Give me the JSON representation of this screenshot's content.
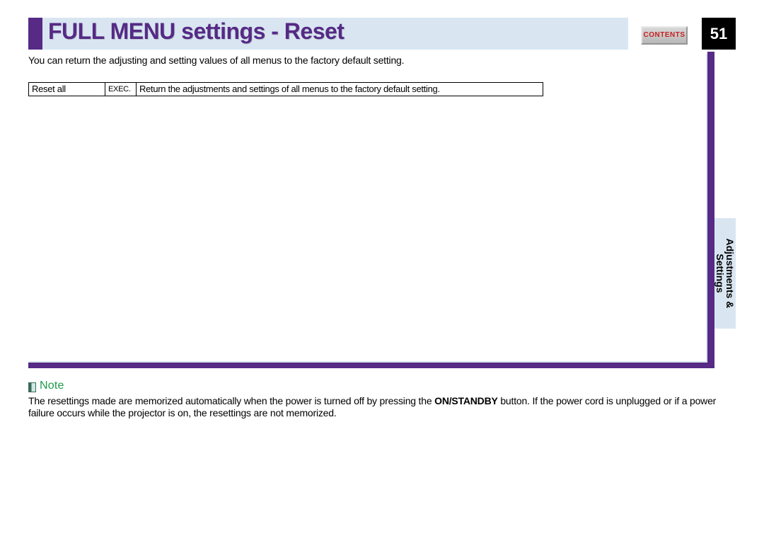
{
  "header": {
    "title": "FULL MENU settings - Reset",
    "contents_label": "CONTENTS",
    "page_number": "51"
  },
  "intro": "You can return the adjusting and setting values of all menus to the factory default setting.",
  "table": {
    "row1": {
      "name": "Reset all",
      "action": "EXEC.",
      "description": "Return the adjustments and settings of all menus to the factory default setting."
    }
  },
  "side_tab": {
    "line1": "Adjustments &",
    "line2": "Settings"
  },
  "note": {
    "label": "Note",
    "body_before": "The resettings made are memorized automatically when the power is turned off by pressing the ",
    "body_bold": "ON/STANDBY",
    "body_after": " button. If the power cord is unplugged or if a power failure occurs while the projector is on, the resettings are not memorized."
  }
}
